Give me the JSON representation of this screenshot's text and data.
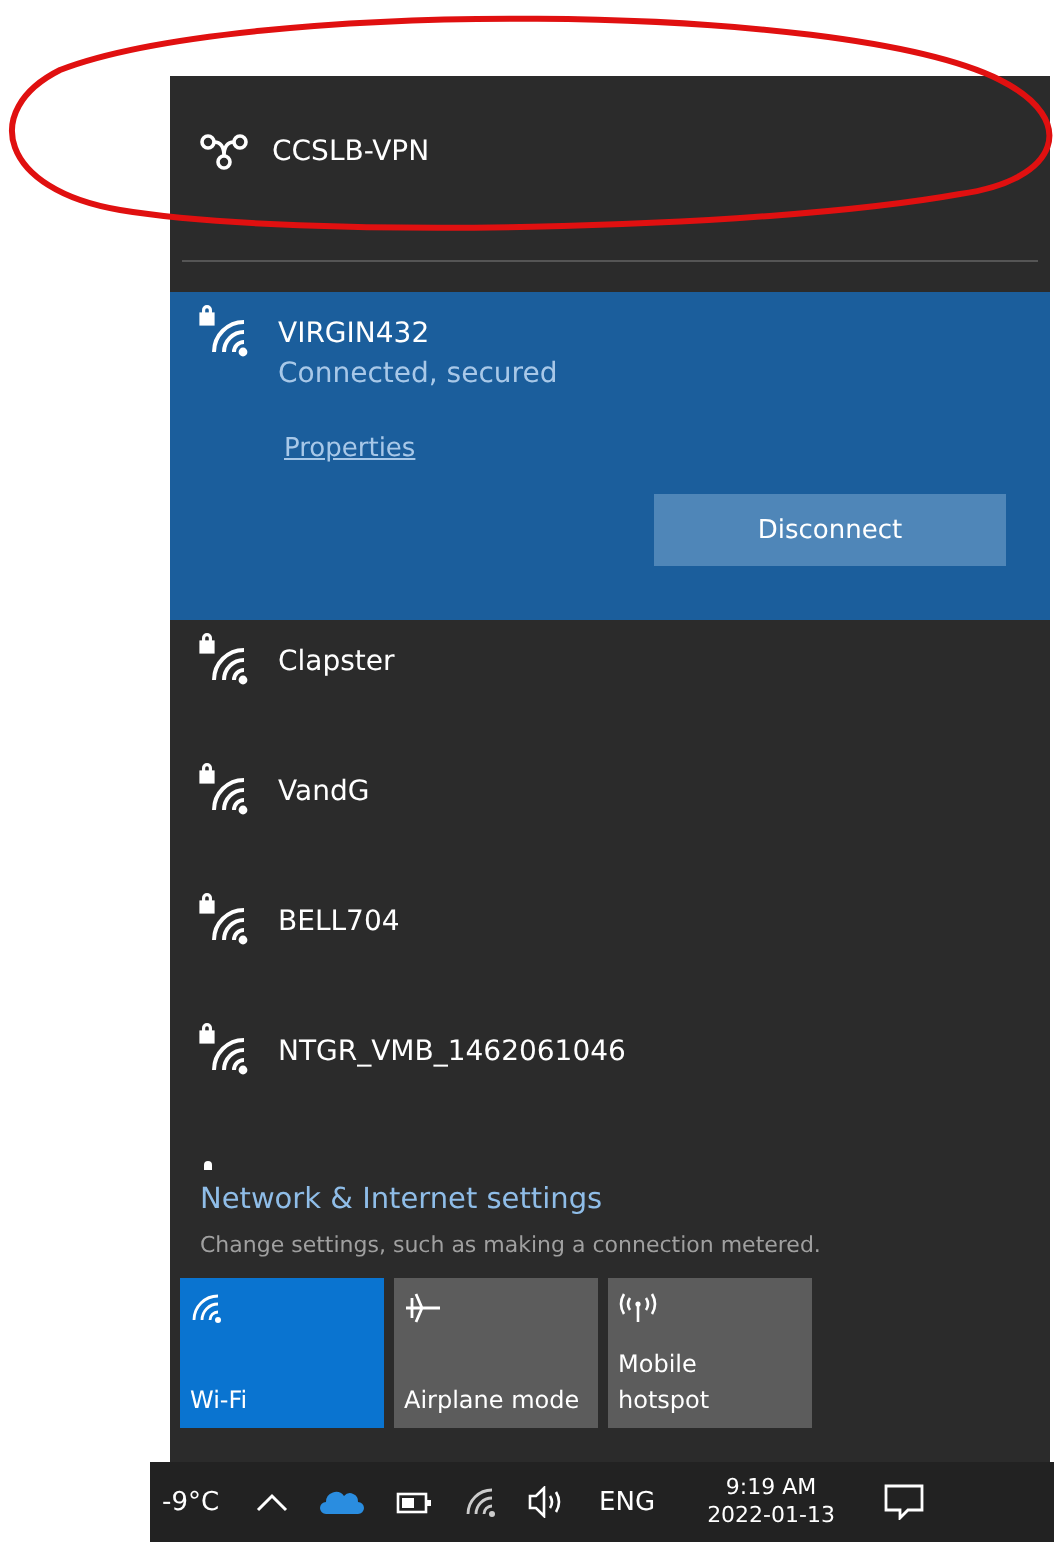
{
  "vpn": {
    "name": "CCSLB-VPN"
  },
  "networks": [
    {
      "name": "VIRGIN432",
      "status": "Connected, secured",
      "link": "Properties",
      "button": "Disconnect",
      "selected": true,
      "secured": true
    },
    {
      "name": "Clapster",
      "selected": false,
      "secured": true
    },
    {
      "name": "VandG",
      "selected": false,
      "secured": true
    },
    {
      "name": "BELL704",
      "selected": false,
      "secured": true
    },
    {
      "name": "NTGR_VMB_1462061046",
      "selected": false,
      "secured": true
    }
  ],
  "settings": {
    "title": "Network & Internet settings",
    "description": "Change settings, such as making a connection metered."
  },
  "quick_actions": [
    {
      "kind": "wifi",
      "label": "Wi-Fi",
      "on": true
    },
    {
      "kind": "airplane",
      "label": "Airplane mode",
      "on": false
    },
    {
      "kind": "hotspot",
      "label": "Mobile hotspot",
      "on": false
    }
  ],
  "taskbar": {
    "temperature": "-9°C",
    "language": "ENG",
    "time": "9:19 AM",
    "date": "2022-01-13"
  }
}
